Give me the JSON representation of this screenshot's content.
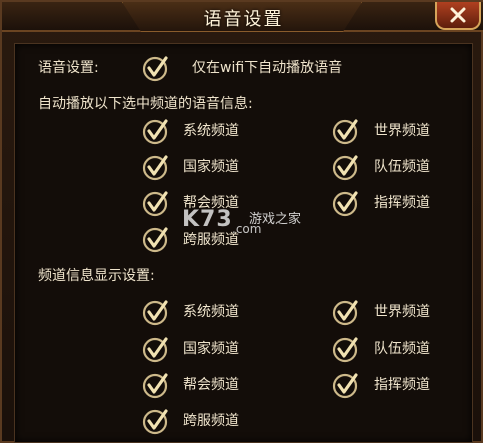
{
  "window": {
    "title": "语音设置"
  },
  "voice_setting": {
    "label": "语音设置:",
    "option_label": "仅在wifi下自动播放语音"
  },
  "auto_play": {
    "heading": "自动播放以下选中频道的语音信息:",
    "channels": [
      "系统频道",
      "世界频道",
      "国家频道",
      "队伍频道",
      "帮会频道",
      "指挥频道",
      "跨服频道"
    ]
  },
  "display": {
    "heading": "频道信息显示设置:",
    "channels": [
      "系统频道",
      "世界频道",
      "国家频道",
      "队伍频道",
      "帮会频道",
      "指挥频道",
      "跨服频道"
    ]
  },
  "watermark": {
    "brand": "K73",
    "text": "游戏之家",
    "domain": ".com"
  },
  "icons": {
    "check": "checkmark-icon",
    "close": "close-icon"
  },
  "colors": {
    "check_gold": "#e8d39a",
    "frame_brown": "#6b4421",
    "close_red": "#b04020"
  }
}
